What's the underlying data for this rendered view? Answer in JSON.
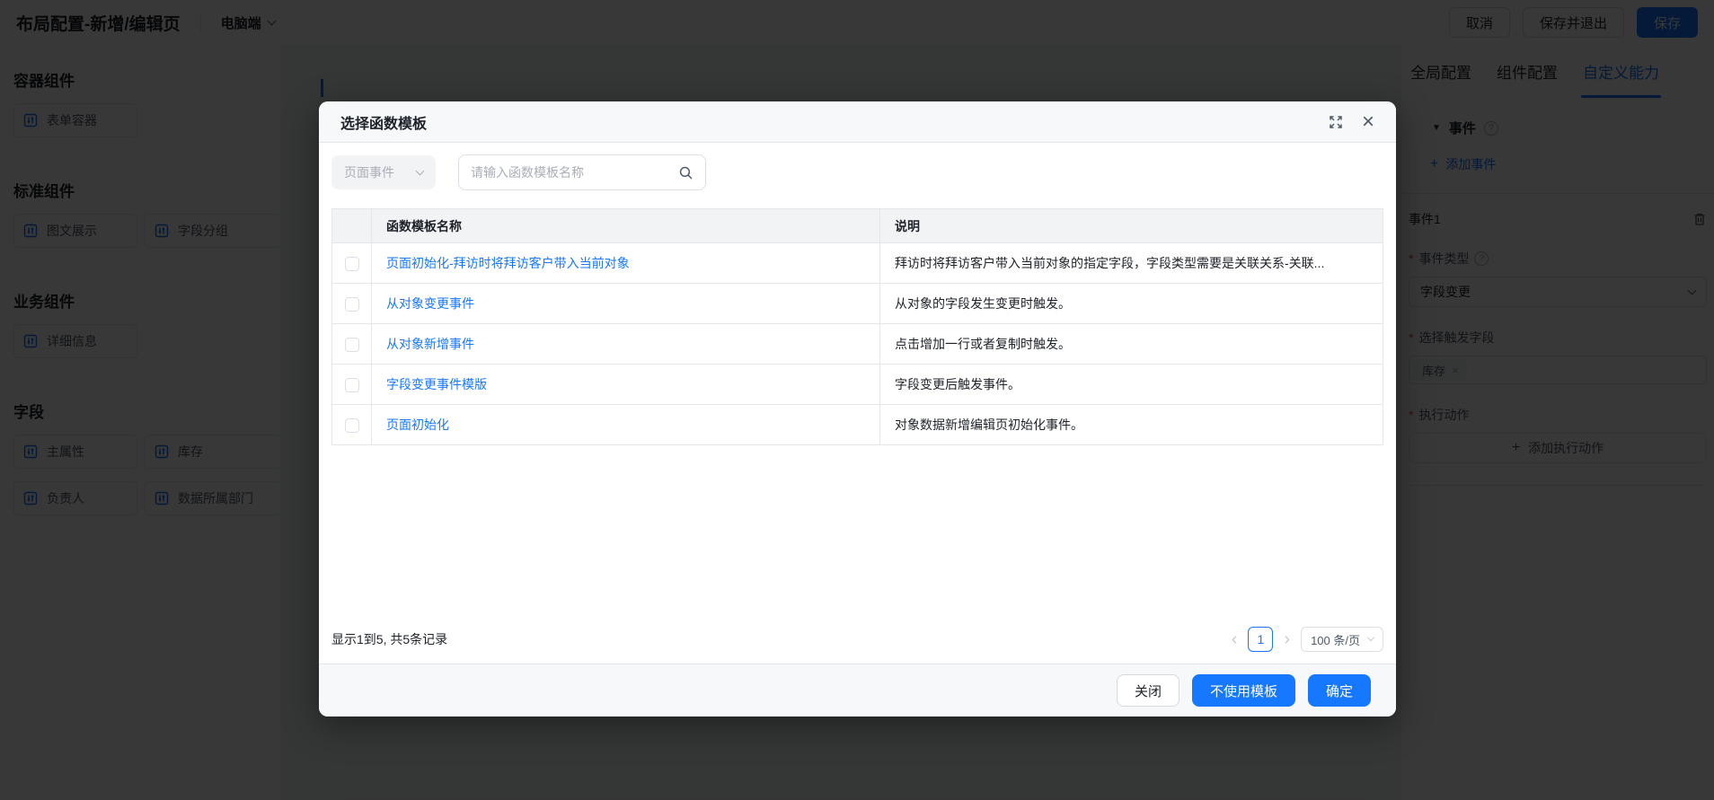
{
  "topbar": {
    "title": "布局配置-新增/编辑页",
    "device_selector": "电脑端",
    "cancel_label": "取消",
    "save_exit_label": "保存并退出",
    "save_label": "保存"
  },
  "left_sidebar": {
    "sections": [
      {
        "title": "容器组件",
        "items": [
          "表单容器"
        ]
      },
      {
        "title": "标准组件",
        "items": [
          "图文展示",
          "字段分组"
        ]
      },
      {
        "title": "业务组件",
        "items": [
          "详细信息"
        ]
      },
      {
        "title": "字段",
        "items": [
          "主属性",
          "库存",
          "负责人",
          "数据所属部门"
        ]
      }
    ]
  },
  "right_sidebar": {
    "tabs": [
      {
        "label": "全局配置"
      },
      {
        "label": "组件配置"
      },
      {
        "label": "自定义能力"
      }
    ],
    "active_tab": "自定义能力",
    "events": {
      "section_title": "事件",
      "add_event_label": "添加事件",
      "event_name": "事件1",
      "type_label": "事件类型",
      "type_value": "字段变更",
      "trigger_label": "选择触发字段",
      "trigger_tag": "库存",
      "action_label": "执行动作",
      "add_action_label": "添加执行动作"
    }
  },
  "modal": {
    "title": "选择函数模板",
    "filter_value": "页面事件",
    "search_placeholder": "请输入函数模板名称",
    "table": {
      "col_name": "函数模板名称",
      "col_desc": "说明",
      "rows": [
        {
          "name": "页面初始化-拜访时将拜访客户带入当前对象",
          "desc": "拜访时将拜访客户带入当前对象的指定字段，字段类型需要是关联关系-关联..."
        },
        {
          "name": "从对象变更事件",
          "desc": "从对象的字段发生变更时触发。"
        },
        {
          "name": "从对象新增事件",
          "desc": "点击增加一行或者复制时触发。"
        },
        {
          "name": "字段变更事件模版",
          "desc": "字段变更后触发事件。"
        },
        {
          "name": "页面初始化",
          "desc": "对象数据新增编辑页初始化事件。"
        }
      ]
    },
    "pagination": {
      "summary": "显示1到5, 共5条记录",
      "current_page": "1",
      "page_size": "100 条/页"
    },
    "footer": {
      "close_label": "关闭",
      "no_template_label": "不使用模板",
      "confirm_label": "确定"
    }
  },
  "icons": {
    "triangle_down": "▼",
    "plus": "+",
    "close": "×",
    "question": "?",
    "asterisk": "*",
    "chevron_left": "‹",
    "chevron_right": "›"
  },
  "colors": {
    "accent": "#1677ff",
    "danger": "#f53f3f",
    "header_bg": "#f7f8fa",
    "table_header_bg": "#f2f3f5"
  }
}
